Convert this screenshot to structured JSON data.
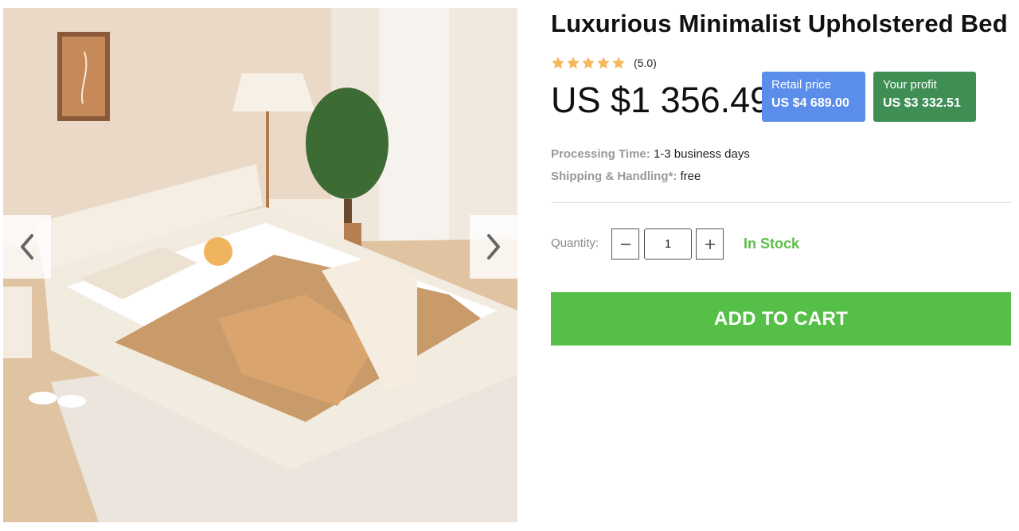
{
  "gallery": {
    "image_alt": "Cream upholstered platform bed in a bright bedroom with tan blanket, striped pillow, floor lamp and rug",
    "prev_icon": "chevron-left-icon",
    "next_icon": "chevron-right-icon"
  },
  "product": {
    "title": "Luxurious Minimalist Upholstered Bed",
    "rating": {
      "stars": 5,
      "text": "(5.0)",
      "star_color": "#f5b85a"
    },
    "price": "US $1 356.49",
    "retail": {
      "label": "Retail price",
      "value": "US $4 689.00",
      "color": "#5b8dea"
    },
    "profit": {
      "label": "Your profit",
      "value": "US $3 332.51",
      "color": "#3f8f55"
    },
    "processing": {
      "label": "Processing Time:",
      "value": "1-3 business days"
    },
    "shipping": {
      "label": "Shipping & Handling*:",
      "value": "free"
    },
    "quantity": {
      "label": "Quantity:",
      "value": "1"
    },
    "stock": {
      "text": "In Stock",
      "color": "#5cbd4a"
    },
    "add_to_cart": {
      "label": "ADD TO CART",
      "color": "#55bf47"
    }
  }
}
